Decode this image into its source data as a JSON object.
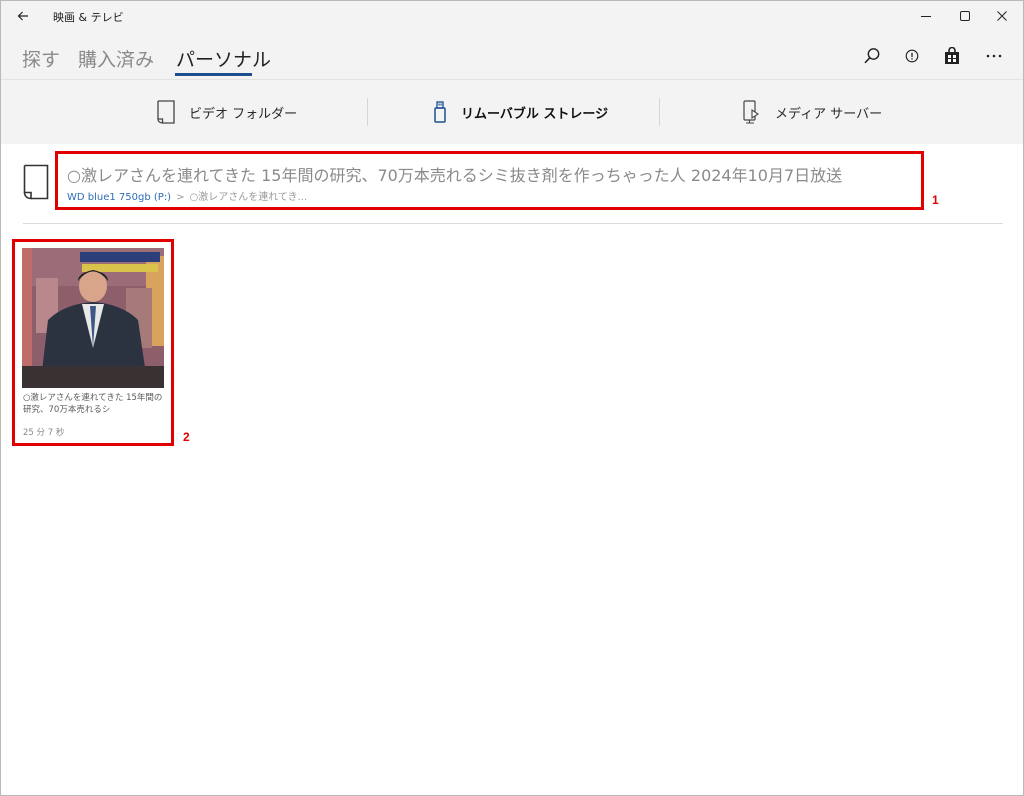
{
  "app": {
    "title": "映画 & テレビ"
  },
  "tabs": [
    {
      "label": "探す",
      "active": false
    },
    {
      "label": "購入済み",
      "active": false
    },
    {
      "label": "パーソナル",
      "active": true
    }
  ],
  "toolbar_icons": [
    "search-icon",
    "info-icon",
    "store-icon",
    "more-icon"
  ],
  "locations": [
    {
      "label": "ビデオ フォルダー",
      "icon": "folder-icon",
      "selected": false
    },
    {
      "label": "リムーバブル ストレージ",
      "icon": "usb-icon",
      "selected": true
    },
    {
      "label": "メディア サーバー",
      "icon": "media-server-icon",
      "selected": false
    }
  ],
  "folder": {
    "title": "○激レアさんを連れてきた 15年間の研究、70万本売れるシミ抜き剤を作っちゃった人 2024年10月7日放送",
    "breadcrumb": {
      "root": "WD blue1 750gb (P:)",
      "separator": ">",
      "current": "○激レアさんを連れてき..."
    }
  },
  "videos": [
    {
      "title": "○激レアさんを連れてきた 15年間の研究、70万本売れるシ",
      "duration": "25 分 7 秒"
    }
  ],
  "annotations": [
    {
      "label": "1"
    },
    {
      "label": "2"
    }
  ],
  "colors": {
    "accent": "#1c4f8f",
    "highlight": "#e00000",
    "link": "#2f6db5",
    "chrome": "#f3f3f3"
  }
}
